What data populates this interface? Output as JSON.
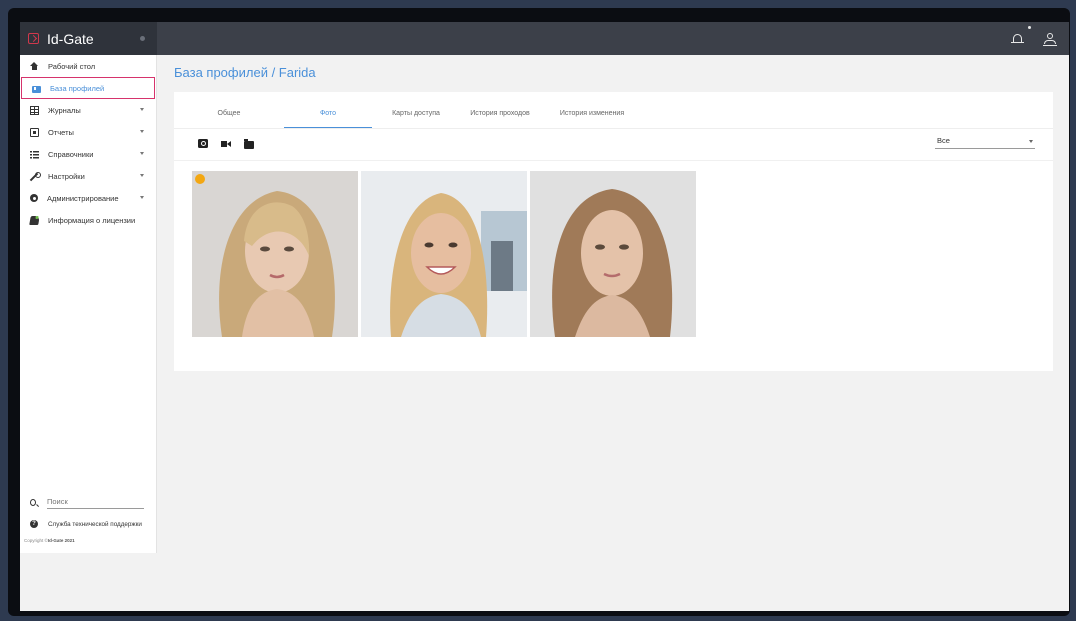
{
  "app": {
    "title": "Id-Gate"
  },
  "colors": {
    "accent": "#4a90d9",
    "active_outline": "#d6336c",
    "topbar": "#3c4049",
    "star": "#f3a712"
  },
  "sidebar": {
    "items": [
      {
        "label": "Рабочий стол",
        "icon": "home-icon"
      },
      {
        "label": "База профилей",
        "icon": "id-card-icon",
        "active": true
      },
      {
        "label": "Журналы",
        "icon": "grid-icon",
        "expandable": true
      },
      {
        "label": "Отчеты",
        "icon": "report-icon",
        "expandable": true
      },
      {
        "label": "Справочники",
        "icon": "list-icon",
        "expandable": true
      },
      {
        "label": "Настройки",
        "icon": "wrench-icon",
        "expandable": true
      },
      {
        "label": "Администрирование",
        "icon": "gear-icon",
        "expandable": true
      },
      {
        "label": "Информация о лицензии",
        "icon": "license-icon"
      }
    ],
    "search_placeholder": "Поиск",
    "support_label": "Служба технической поддержки",
    "copyright_prefix": "Copyright ©",
    "copyright_brand": "Id-Gate 2021"
  },
  "main": {
    "breadcrumb": "База профилей / Farida",
    "tabs": [
      {
        "label": "Общее"
      },
      {
        "label": "Фото",
        "active": true
      },
      {
        "label": "Карты доступа"
      },
      {
        "label": "История проходов"
      },
      {
        "label": "История изменения"
      }
    ],
    "filter": {
      "selected": "Все"
    },
    "photos": [
      {
        "name": "photo-1",
        "primary": true
      },
      {
        "name": "photo-2",
        "primary": false
      },
      {
        "name": "photo-3",
        "primary": false
      }
    ]
  }
}
